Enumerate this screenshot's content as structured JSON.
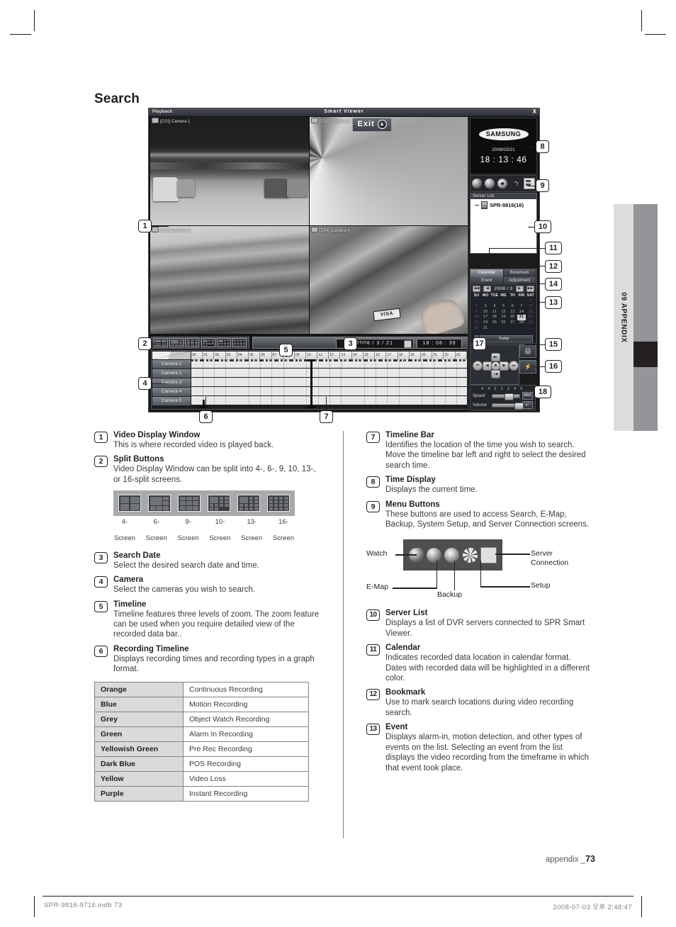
{
  "page": {
    "title": "Search",
    "side_tab": "09 APPENDIX",
    "footer_label": "appendix _",
    "footer_page": "73",
    "print_left": "SPR-9816-9716.indb   73",
    "print_right": "2008-07-03   오후 2:48:47"
  },
  "app": {
    "titlebar": {
      "left": "Playback",
      "center": "Smart Viewer",
      "close": "X"
    },
    "exit_label": "Exit",
    "cameras": [
      {
        "label": "[C01] Camera 1"
      },
      {
        "label": "[C02] Camera 2"
      },
      {
        "label": "[C03] Camera 3"
      },
      {
        "label": "[C04] Camera 4"
      }
    ],
    "visa_label": "VISA",
    "time_display": {
      "date": "2008/03/21",
      "clock": "18 : 13 : 46"
    },
    "samsung_logo": "SAMSUNG",
    "menu_buttons": [
      {
        "name": "watch-button",
        "label": "Watch"
      },
      {
        "name": "emap-button",
        "label": "E-Map"
      },
      {
        "name": "backup-button",
        "label": "Backup"
      },
      {
        "name": "setup-button",
        "label": "Setup"
      },
      {
        "name": "server-connection-button",
        "label": "Server Connection"
      }
    ],
    "server_list": {
      "header": "Server List",
      "item": "SPR-9816(16)"
    },
    "calendar": {
      "tabs": [
        "Calendar",
        "Bookmark",
        "Event",
        "Adjustment"
      ],
      "month": "2008 / 3",
      "weekdays": [
        "SU",
        "MO",
        "TUE",
        "WE",
        "TH",
        "FRI",
        "SAT"
      ],
      "weeks": [
        [
          "",
          "",
          "",
          "",
          "",
          "",
          "1"
        ],
        [
          "2",
          "3",
          "4",
          "5",
          "6",
          "7",
          "8"
        ],
        [
          "9",
          "10",
          "11",
          "12",
          "13",
          "14",
          "15"
        ],
        [
          "16",
          "17",
          "18",
          "19",
          "20",
          "21",
          "22"
        ],
        [
          "23",
          "24",
          "25",
          "26",
          "27",
          "28",
          "29"
        ],
        [
          "30",
          "31",
          "",
          "",
          "",
          "",
          ""
        ]
      ],
      "selected_day": "21",
      "today_label": "Today"
    },
    "search_date_value": "2008  /  3  /  21",
    "search_time_value": "18  :  08  :  39",
    "timeline": {
      "hour_ticks": [
        "00",
        "01",
        "02",
        "03",
        "04",
        "05",
        "06",
        "07",
        "08",
        "09",
        "10",
        "11",
        "12",
        "13",
        "14",
        "15",
        "16",
        "17",
        "18",
        "19",
        "20",
        "21",
        "22",
        "23"
      ],
      "camera_rows": [
        "Camera 1",
        "Camera 2",
        "Camera 3",
        "Camera 4",
        "Camera 5"
      ]
    },
    "transport": {
      "speed_label": "Speed",
      "volume_label": "Volume",
      "speed_scale": "6 4 2 1 2 4 6",
      "max_label": "MAX"
    }
  },
  "callouts": [
    "1",
    "2",
    "3",
    "4",
    "5",
    "6",
    "7",
    "8",
    "9",
    "10",
    "11",
    "12",
    "13",
    "14",
    "15",
    "16",
    "17",
    "18"
  ],
  "descriptions_left": [
    {
      "num": "1",
      "title": "Video Display Window",
      "body": "This is where recorded video is played back."
    },
    {
      "num": "2",
      "title": "Split Buttons",
      "body": "Video Display Window can be split into 4-, 6-, 9, 10, 13-, or 16-split screens."
    },
    {
      "num": "3",
      "title": "Search Date",
      "body": "Select the desired search date and time."
    },
    {
      "num": "4",
      "title": "Camera",
      "body": "Select the cameras you wish to search."
    },
    {
      "num": "5",
      "title": "Timeline",
      "body": "Timeline features three levels of zoom. The zoom feature can be used when you require detailed view of the recorded data bar.."
    },
    {
      "num": "6",
      "title": "Recording Timeline",
      "body": "Displays recording times and recording types in a graph format."
    }
  ],
  "split_figure": {
    "items": [
      {
        "icon": "split-4-icon",
        "line1": "4-",
        "line2": "Screen"
      },
      {
        "icon": "split-6-icon",
        "line1": "6-",
        "line2": "Screen"
      },
      {
        "icon": "split-9-icon",
        "line1": "9-",
        "line2": "Screen"
      },
      {
        "icon": "split-10-icon",
        "line1": "10-",
        "line2": "Screen"
      },
      {
        "icon": "split-13-icon",
        "line1": "13-",
        "line2": "Screen"
      },
      {
        "icon": "split-16-icon",
        "line1": "16-",
        "line2": "Screen"
      }
    ]
  },
  "legend_table": {
    "rows": [
      {
        "color": "Orange",
        "meaning": "Continuous Recording"
      },
      {
        "color": "Blue",
        "meaning": "Motion Recording"
      },
      {
        "color": "Grey",
        "meaning": "Object Watch Recording"
      },
      {
        "color": "Green",
        "meaning": "Alarm In Recording"
      },
      {
        "color": "Yellowish Green",
        "meaning": "Pre Rec Recording"
      },
      {
        "color": "Dark Blue",
        "meaning": "POS Recording"
      },
      {
        "color": "Yellow",
        "meaning": "Video Loss"
      },
      {
        "color": "Purple",
        "meaning": "Instant Recording"
      }
    ]
  },
  "descriptions_right_top": [
    {
      "num": "7",
      "title": "Timeline Bar",
      "body": "Identifies the location of the time you wish to search. Move the timeline bar left and right to select the desired search time."
    },
    {
      "num": "8",
      "title": "Time Display",
      "body": "Displays the current time."
    },
    {
      "num": "9",
      "title": "Menu Buttons",
      "body": "These buttons are used to access Search, E-Map, Backup, System Setup, and Server Connection screens."
    }
  ],
  "menu_figure_labels": {
    "watch": "Watch",
    "emap": "E-Map",
    "backup": "Backup",
    "setup": "Setup",
    "server_connection_line1": "Server",
    "server_connection_line2": "Connection"
  },
  "descriptions_right_bottom": [
    {
      "num": "10",
      "title": "Server List",
      "body": "Displays a list of DVR servers connected to SPR Smart Viewer."
    },
    {
      "num": "11",
      "title": "Calendar",
      "body": "Indicates recorded data location in calendar format. Dates with recorded data will be highlighted in a different color."
    },
    {
      "num": "12",
      "title": "Bookmark",
      "body": "Use to mark search locations during video recording search."
    },
    {
      "num": "13",
      "title": "Event",
      "body": "Displays alarm-in, motion detection, and other types of events on the list. Selecting an event from the list displays the video recording from the timeframe in which that event took place."
    }
  ]
}
